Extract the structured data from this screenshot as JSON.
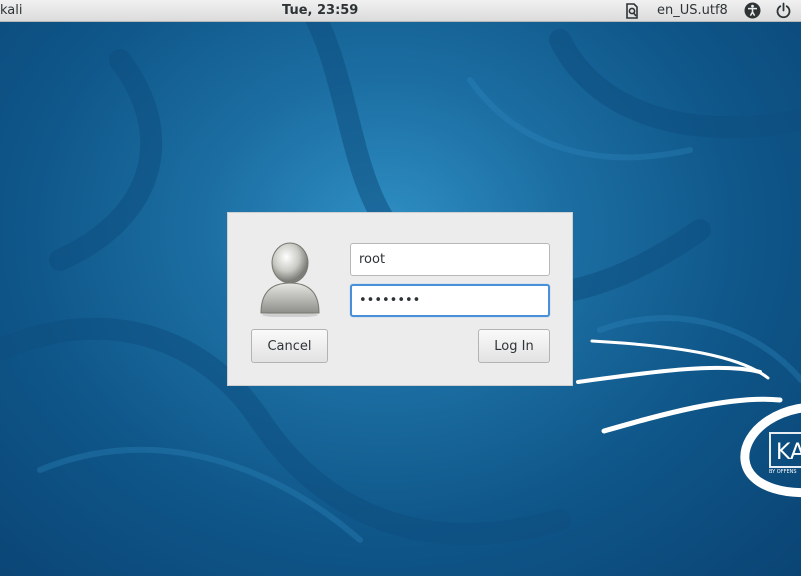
{
  "top_bar": {
    "host": "kali",
    "clock": "Tue, 23:59",
    "locale": "en_US.utf8",
    "icons": [
      "keyboard-icon",
      "accessibility-icon",
      "power-icon"
    ]
  },
  "login_dialog": {
    "username_value": "root",
    "password_value": "••••••••",
    "cancel_label": "Cancel",
    "login_label": "Log In",
    "avatar_icon": "user-avatar-icon",
    "focused_field": "password"
  },
  "wallpaper": {
    "brand_mark": "KA",
    "brand_tagline": "BY OFFENS",
    "colors": {
      "background": "#0f5689",
      "accent": "#4a90d9"
    }
  }
}
